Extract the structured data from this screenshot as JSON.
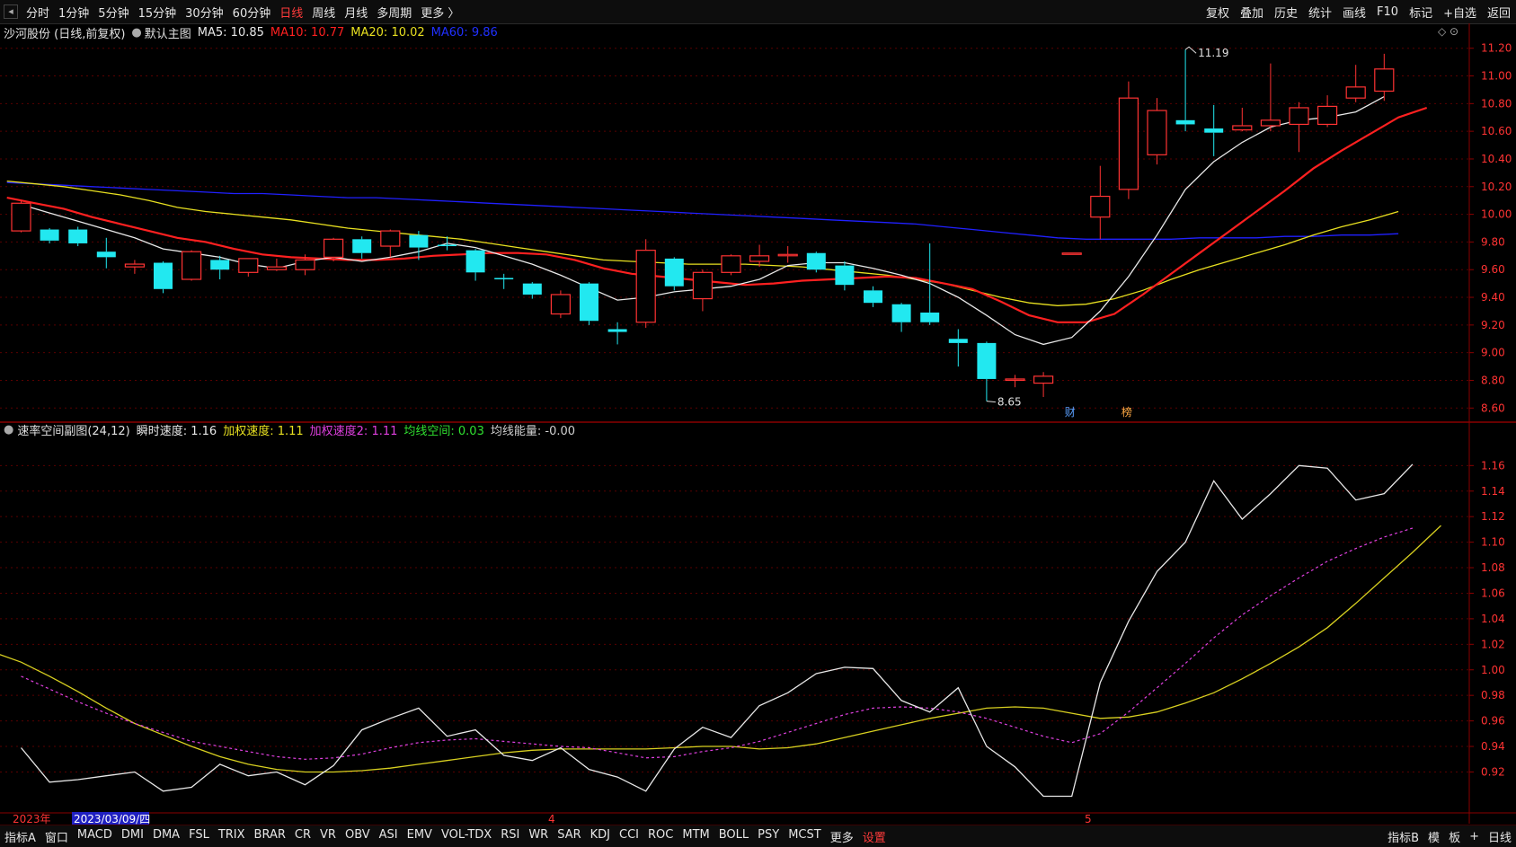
{
  "topbar": {
    "periods": [
      "分时",
      "1分钟",
      "5分钟",
      "15分钟",
      "30分钟",
      "60分钟",
      "日线",
      "周线",
      "月线",
      "多周期",
      "更多 〉"
    ],
    "active_period": "日线",
    "tools": [
      "复权",
      "叠加",
      "历史",
      "统计",
      "画线",
      "F10",
      "标记",
      "+自选",
      "返回"
    ]
  },
  "main_legend": {
    "stock": "沙河股份 (日线,前复权)",
    "template": "默认主图",
    "ma5": "MA5: 10.85",
    "ma10": "MA10: 10.77",
    "ma20": "MA20: 10.02",
    "ma60": "MA60: 9.86"
  },
  "sub_legend": {
    "name": "速率空间副图(24,12)",
    "instant": "瞬时速度: 1.16",
    "weighted": "加权速度: 1.11",
    "weighted2": "加权速度2: 1.11",
    "space": "均线空间: 0.03",
    "energy": "均线能量: -0.00"
  },
  "colors": {
    "up": "#ff3333",
    "down": "#22e8f0",
    "ma5": "#e8e8e8",
    "ma10": "#ff2020",
    "ma20": "#e8e020",
    "ma60": "#2020ff",
    "grid": "#5a0000"
  },
  "price_axis": {
    "ticks": [
      "11.20",
      "11.00",
      "10.80",
      "10.60",
      "10.40",
      "10.20",
      "10.00",
      "9.80",
      "9.60",
      "9.40",
      "9.20",
      "9.00",
      "8.80",
      "8.60"
    ],
    "min": 8.55,
    "max": 11.25
  },
  "sub_axis": {
    "ticks": [
      "1.16",
      "1.14",
      "1.12",
      "1.10",
      "1.08",
      "1.06",
      "1.04",
      "1.02",
      "1.00",
      "0.98",
      "0.96",
      "0.94",
      "0.92"
    ],
    "min": 0.895,
    "max": 1.175
  },
  "annotations": {
    "high": "11.19",
    "low": "8.65",
    "marker_cai": "财",
    "marker_bang": "榜"
  },
  "time_axis": {
    "year": "2023年",
    "cursor_date": "2023/03/09/四",
    "month_april": "4",
    "month_may": "5"
  },
  "bottombar": {
    "indicators": [
      "指标A",
      "窗口",
      "MACD",
      "DMI",
      "DMA",
      "FSL",
      "TRIX",
      "BRAR",
      "CR",
      "VR",
      "OBV",
      "ASI",
      "EMV",
      "VOL-TDX",
      "RSI",
      "WR",
      "SAR",
      "KDJ",
      "CCI",
      "ROC",
      "MTM",
      "BOLL",
      "PSY",
      "MCST",
      "更多",
      "设置"
    ],
    "right": [
      "指标B",
      "模",
      "板",
      "+",
      "日线"
    ]
  },
  "chart_data": [
    {
      "type": "candlestick",
      "title": "沙河股份 (日线,前复权)",
      "candles": [
        {
          "o": 9.88,
          "c": 10.08,
          "h": 10.1,
          "l": 9.87
        },
        {
          "o": 9.89,
          "c": 9.81,
          "h": 9.9,
          "l": 9.79
        },
        {
          "o": 9.89,
          "c": 9.79,
          "h": 9.91,
          "l": 9.77
        },
        {
          "o": 9.73,
          "c": 9.69,
          "h": 9.83,
          "l": 9.61
        },
        {
          "o": 9.62,
          "c": 9.64,
          "h": 9.67,
          "l": 9.57
        },
        {
          "o": 9.65,
          "c": 9.46,
          "h": 9.66,
          "l": 9.43
        },
        {
          "o": 9.53,
          "c": 9.73,
          "h": 9.74,
          "l": 9.52
        },
        {
          "o": 9.67,
          "c": 9.6,
          "h": 9.7,
          "l": 9.53
        },
        {
          "o": 9.58,
          "c": 9.68,
          "h": 9.68,
          "l": 9.55
        },
        {
          "o": 9.6,
          "c": 9.62,
          "h": 9.68,
          "l": 9.59
        },
        {
          "o": 9.6,
          "c": 9.67,
          "h": 9.71,
          "l": 9.56
        },
        {
          "o": 9.69,
          "c": 9.82,
          "h": 9.83,
          "l": 9.66
        },
        {
          "o": 9.82,
          "c": 9.72,
          "h": 9.84,
          "l": 9.68
        },
        {
          "o": 9.77,
          "c": 9.88,
          "h": 9.89,
          "l": 9.69
        },
        {
          "o": 9.85,
          "c": 9.76,
          "h": 9.88,
          "l": 9.67
        },
        {
          "o": 9.78,
          "c": 9.77,
          "h": 9.84,
          "l": 9.74
        },
        {
          "o": 9.74,
          "c": 9.58,
          "h": 9.75,
          "l": 9.52
        },
        {
          "o": 9.54,
          "c": 9.53,
          "h": 9.57,
          "l": 9.46
        },
        {
          "o": 9.5,
          "c": 9.42,
          "h": 9.51,
          "l": 9.39
        },
        {
          "o": 9.28,
          "c": 9.42,
          "h": 9.45,
          "l": 9.25
        },
        {
          "o": 9.5,
          "c": 9.23,
          "h": 9.51,
          "l": 9.2
        },
        {
          "o": 9.17,
          "c": 9.15,
          "h": 9.22,
          "l": 9.06
        },
        {
          "o": 9.22,
          "c": 9.74,
          "h": 9.82,
          "l": 9.18
        },
        {
          "o": 9.68,
          "c": 9.48,
          "h": 9.69,
          "l": 9.45
        },
        {
          "o": 9.39,
          "c": 9.58,
          "h": 9.6,
          "l": 9.3
        },
        {
          "o": 9.58,
          "c": 9.7,
          "h": 9.71,
          "l": 9.56
        },
        {
          "o": 9.66,
          "c": 9.7,
          "h": 9.78,
          "l": 9.62
        },
        {
          "o": 9.71,
          "c": 9.71,
          "h": 9.77,
          "l": 9.65
        },
        {
          "o": 9.72,
          "c": 9.6,
          "h": 9.73,
          "l": 9.58
        },
        {
          "o": 9.63,
          "c": 9.49,
          "h": 9.66,
          "l": 9.45
        },
        {
          "o": 9.45,
          "c": 9.36,
          "h": 9.48,
          "l": 9.33
        },
        {
          "o": 9.35,
          "c": 9.22,
          "h": 9.36,
          "l": 9.15
        },
        {
          "o": 9.29,
          "c": 9.22,
          "h": 9.79,
          "l": 9.2
        },
        {
          "o": 9.1,
          "c": 9.07,
          "h": 9.17,
          "l": 8.9
        },
        {
          "o": 9.07,
          "c": 8.81,
          "h": 9.08,
          "l": 8.65
        },
        {
          "o": 8.81,
          "c": 8.81,
          "h": 8.84,
          "l": 8.75
        },
        {
          "o": 8.78,
          "c": 8.83,
          "h": 8.86,
          "l": 8.68
        },
        {
          "o": 9.72,
          "c": 9.72,
          "h": 9.72,
          "l": 9.72
        },
        {
          "o": 9.98,
          "c": 10.13,
          "h": 10.35,
          "l": 9.82
        },
        {
          "o": 10.18,
          "c": 10.84,
          "h": 10.96,
          "l": 10.11
        },
        {
          "o": 10.43,
          "c": 10.75,
          "h": 10.84,
          "l": 10.36
        },
        {
          "o": 10.68,
          "c": 10.65,
          "h": 11.19,
          "l": 10.6
        },
        {
          "o": 10.62,
          "c": 10.59,
          "h": 10.79,
          "l": 10.42
        },
        {
          "o": 10.61,
          "c": 10.64,
          "h": 10.77,
          "l": 10.6
        },
        {
          "o": 10.64,
          "c": 10.68,
          "h": 11.09,
          "l": 10.6
        },
        {
          "o": 10.65,
          "c": 10.77,
          "h": 10.81,
          "l": 10.45
        },
        {
          "o": 10.65,
          "c": 10.78,
          "h": 10.86,
          "l": 10.63
        },
        {
          "o": 10.84,
          "c": 10.92,
          "h": 11.08,
          "l": 10.81
        },
        {
          "o": 10.89,
          "c": 11.05,
          "h": 11.16,
          "l": 10.82
        }
      ],
      "ma5": [
        10.07,
        10.01,
        9.95,
        9.89,
        9.83,
        9.75,
        9.72,
        9.69,
        9.64,
        9.61,
        9.66,
        9.69,
        9.66,
        9.69,
        9.73,
        9.79,
        9.76,
        9.7,
        9.64,
        9.56,
        9.47,
        9.38,
        9.4,
        9.44,
        9.46,
        9.48,
        9.53,
        9.63,
        9.65,
        9.65,
        9.61,
        9.56,
        9.5,
        9.4,
        9.27,
        9.13,
        9.06,
        9.11,
        9.3,
        9.55,
        9.85,
        10.18,
        10.38,
        10.52,
        10.63,
        10.68,
        10.7,
        10.74,
        10.85
      ],
      "ma10": [
        10.12,
        10.08,
        10.04,
        9.98,
        9.93,
        9.88,
        9.83,
        9.8,
        9.75,
        9.71,
        9.69,
        9.68,
        9.67,
        9.67,
        9.68,
        9.7,
        9.71,
        9.72,
        9.72,
        9.71,
        9.67,
        9.61,
        9.57,
        9.55,
        9.53,
        9.51,
        9.49,
        9.5,
        9.52,
        9.53,
        9.54,
        9.55,
        9.54,
        9.5,
        9.46,
        9.37,
        9.27,
        9.22,
        9.22,
        9.28,
        9.42,
        9.57,
        9.72,
        9.87,
        10.02,
        10.17,
        10.33,
        10.46,
        10.58,
        10.7,
        10.77
      ],
      "ma20": [
        10.24,
        10.22,
        10.2,
        10.17,
        10.14,
        10.1,
        10.05,
        10.02,
        10.0,
        9.98,
        9.96,
        9.93,
        9.9,
        9.88,
        9.86,
        9.84,
        9.82,
        9.79,
        9.76,
        9.73,
        9.7,
        9.67,
        9.66,
        9.65,
        9.64,
        9.64,
        9.64,
        9.63,
        9.62,
        9.6,
        9.58,
        9.56,
        9.53,
        9.5,
        9.45,
        9.4,
        9.36,
        9.34,
        9.35,
        9.39,
        9.45,
        9.53,
        9.6,
        9.66,
        9.72,
        9.78,
        9.85,
        9.91,
        9.96,
        10.02
      ],
      "ma60": [
        10.23,
        10.22,
        10.21,
        10.2,
        10.19,
        10.18,
        10.17,
        10.16,
        10.15,
        10.15,
        10.14,
        10.13,
        10.12,
        10.12,
        10.11,
        10.1,
        10.09,
        10.08,
        10.07,
        10.06,
        10.05,
        10.04,
        10.03,
        10.02,
        10.01,
        10.0,
        9.99,
        9.98,
        9.97,
        9.96,
        9.95,
        9.94,
        9.93,
        9.91,
        9.89,
        9.87,
        9.85,
        9.83,
        9.82,
        9.82,
        9.82,
        9.82,
        9.83,
        9.83,
        9.83,
        9.84,
        9.84,
        9.85,
        9.85,
        9.86
      ]
    },
    {
      "type": "line",
      "title": "速率空间副图(24,12)",
      "series": [
        {
          "name": "瞬时速度",
          "values": [
            0.939,
            0.912,
            0.914,
            0.917,
            0.92,
            0.905,
            0.908,
            0.926,
            0.917,
            0.92,
            0.91,
            0.925,
            0.953,
            0.962,
            0.97,
            0.948,
            0.953,
            0.933,
            0.929,
            0.939,
            0.922,
            0.916,
            0.905,
            0.938,
            0.955,
            0.947,
            0.972,
            0.982,
            0.997,
            1.002,
            1.001,
            0.976,
            0.967,
            0.986,
            0.94,
            0.924,
            0.901,
            0.901,
            0.99,
            1.038,
            1.077,
            1.1,
            1.148,
            1.118,
            1.138,
            1.16,
            1.158,
            1.133,
            1.138,
            1.161
          ]
        },
        {
          "name": "加权速度",
          "values": [
            1.014,
            1.006,
            0.995,
            0.983,
            0.97,
            0.958,
            0.949,
            0.94,
            0.932,
            0.926,
            0.922,
            0.92,
            0.92,
            0.921,
            0.923,
            0.926,
            0.929,
            0.932,
            0.935,
            0.937,
            0.938,
            0.938,
            0.938,
            0.938,
            0.939,
            0.94,
            0.94,
            0.938,
            0.939,
            0.942,
            0.947,
            0.952,
            0.957,
            0.962,
            0.966,
            0.97,
            0.971,
            0.97,
            0.966,
            0.962,
            0.963,
            0.967,
            0.974,
            0.982,
            0.993,
            1.005,
            1.018,
            1.033,
            1.052,
            1.072,
            1.092,
            1.113
          ]
        },
        {
          "name": "加权速度2",
          "values": [
            0.995,
            0.985,
            0.975,
            0.966,
            0.958,
            0.951,
            0.944,
            0.94,
            0.936,
            0.932,
            0.93,
            0.931,
            0.934,
            0.939,
            0.943,
            0.945,
            0.946,
            0.944,
            0.942,
            0.94,
            0.939,
            0.935,
            0.931,
            0.932,
            0.936,
            0.939,
            0.944,
            0.951,
            0.958,
            0.965,
            0.97,
            0.971,
            0.97,
            0.967,
            0.962,
            0.955,
            0.948,
            0.943,
            0.95,
            0.967,
            0.986,
            1.005,
            1.025,
            1.043,
            1.058,
            1.072,
            1.085,
            1.095,
            1.104,
            1.111
          ]
        }
      ],
      "ylim": [
        0.895,
        1.175
      ]
    }
  ]
}
